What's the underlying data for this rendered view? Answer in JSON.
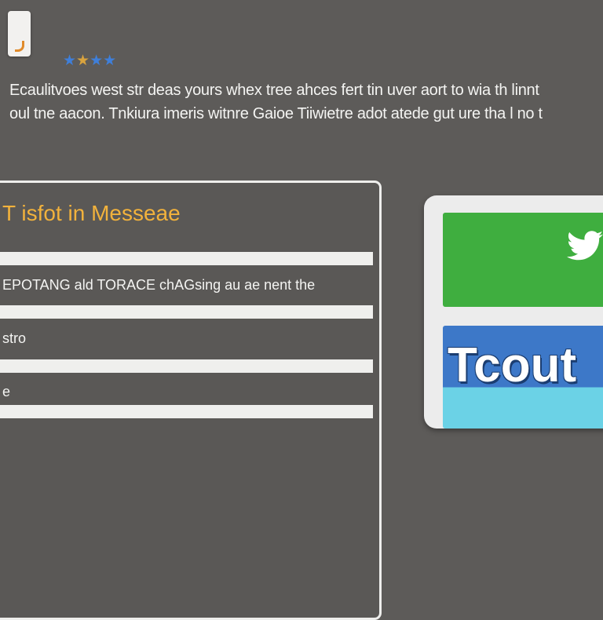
{
  "app_icon": {
    "icon": "document-icon"
  },
  "rating": {
    "icon": "star-icon",
    "stars": [
      "★",
      "★",
      "★",
      "★"
    ]
  },
  "intro": {
    "line1": "Ecaulitvoes west str deas yours whex tree ahces fert tin uver aort to wia th linnt",
    "line2": "oul tne aacon. Tnkiura imeris witnre Gaioe Tiiwietre adot atede gut ure tha l no t"
  },
  "panel": {
    "title": "T isfot in Messeae",
    "rows": [
      "EPOTANG ald TORACE chAGsing au ae nent the",
      "stro",
      "e"
    ]
  },
  "twitter_card": {
    "bird_icon": "twitter-bird-icon",
    "label": "Tcout",
    "colors": {
      "green": "#3fae3f",
      "blue": "#3d78c8",
      "cyan": "#6bd2e6"
    }
  }
}
